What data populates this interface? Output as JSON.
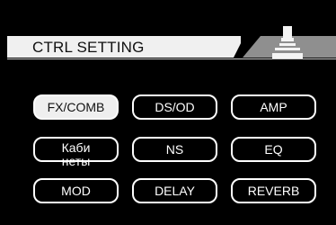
{
  "header": {
    "title": "CTRL SETTING",
    "icon": "pedal-device-icon"
  },
  "buttons": [
    {
      "label": "FX/COMB",
      "active": true
    },
    {
      "label": "DS/OD",
      "active": false
    },
    {
      "label": "AMP",
      "active": false
    },
    {
      "label": "Каби\nнеты",
      "active": false
    },
    {
      "label": "NS",
      "active": false
    },
    {
      "label": "EQ",
      "active": false
    },
    {
      "label": "MOD",
      "active": false
    },
    {
      "label": "DELAY",
      "active": false
    },
    {
      "label": "REVERB",
      "active": false
    }
  ],
  "colors": {
    "background": "#000000",
    "header_light": "#f0f0f0",
    "header_gray": "#8f8f8f",
    "active_button": "#efefef",
    "button_border": "#ffffff"
  }
}
